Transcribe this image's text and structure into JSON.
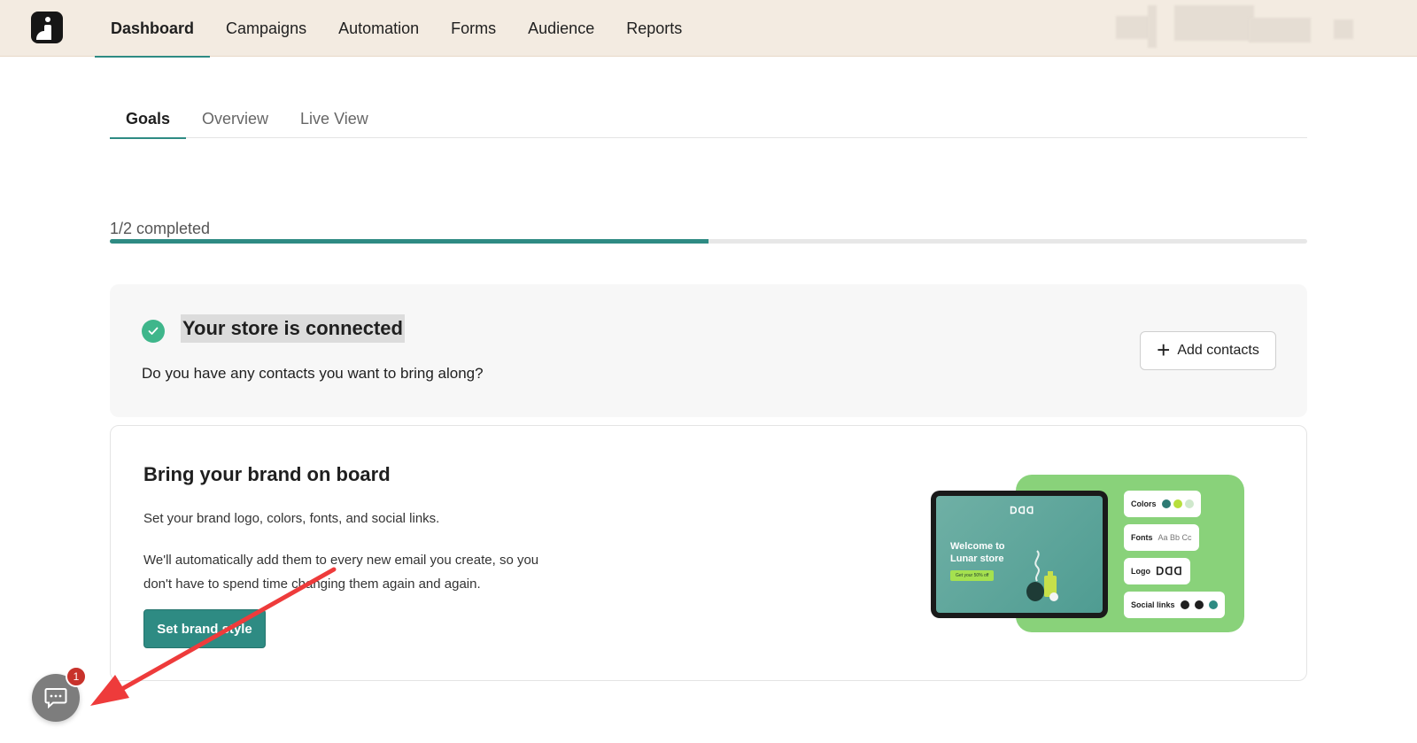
{
  "nav": {
    "items": [
      {
        "label": "Dashboard",
        "active": true
      },
      {
        "label": "Campaigns",
        "active": false
      },
      {
        "label": "Automation",
        "active": false
      },
      {
        "label": "Forms",
        "active": false
      },
      {
        "label": "Audience",
        "active": false
      },
      {
        "label": "Reports",
        "active": false
      }
    ]
  },
  "subtabs": [
    {
      "label": "Goals",
      "active": true
    },
    {
      "label": "Overview",
      "active": false
    },
    {
      "label": "Live View",
      "active": false
    }
  ],
  "progress": {
    "label": "1/2 completed",
    "fraction": 0.5
  },
  "store_card": {
    "title": "Your store is connected",
    "subtitle": "Do you have any contacts you want to bring along?",
    "button": "Add contacts"
  },
  "brand_card": {
    "title": "Bring your brand on board",
    "p1": "Set your brand logo, colors, fonts, and social links.",
    "p2": "We'll automatically add them to every new email you create, so you don't have to spend time changing them again and again.",
    "button": "Set brand style"
  },
  "illustration": {
    "screen_title": "Welcome to Lunar store",
    "screen_button": "Get your 50% off",
    "chips": {
      "colors": "Colors",
      "fonts": "Fonts",
      "fonts_sample": "Aa Bb Cc",
      "logo": "Logo",
      "social": "Social links"
    }
  },
  "chat": {
    "badge": "1"
  },
  "colors": {
    "accent": "#2e8b83",
    "success": "#3fb68b",
    "topbar": "#f3ebe1",
    "badge": "#c8322b",
    "annotation": "#ee3b3b"
  }
}
